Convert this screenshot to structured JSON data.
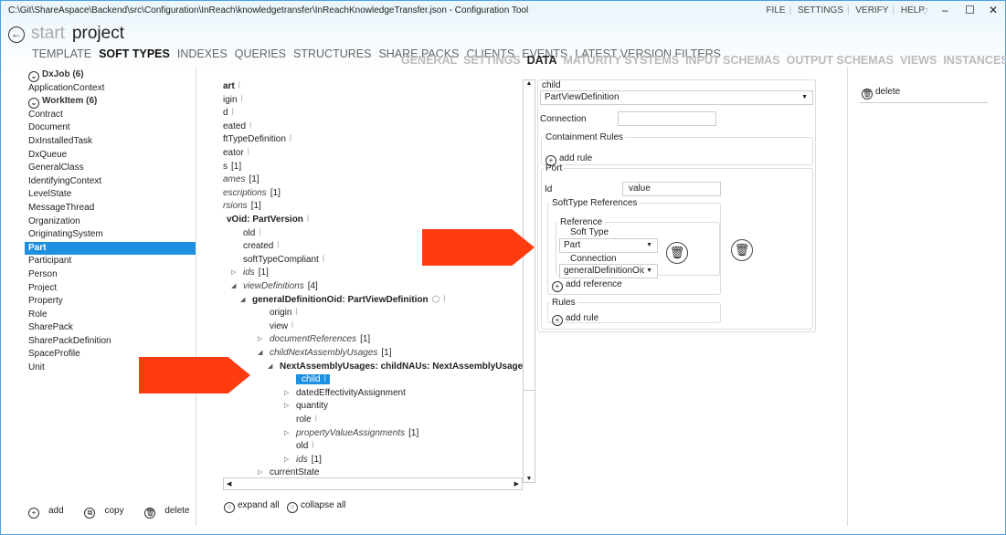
{
  "window": {
    "title": "C:\\Git\\ShareAspace\\Backend\\src\\Configuration\\InReach\\knowledgetransfer\\InReachKnowledgeTransfer.json - Configuration Tool",
    "menu": [
      "FILE",
      "SETTINGS",
      "VERIFY",
      "HELP"
    ]
  },
  "breadcrumb": {
    "start": "start",
    "project": "project"
  },
  "tabs_primary": [
    {
      "label": "TEMPLATE"
    },
    {
      "label": "SOFT TYPES",
      "active": true
    },
    {
      "label": "INDEXES"
    },
    {
      "label": "QUERIES"
    },
    {
      "label": "STRUCTURES"
    },
    {
      "label": "SHARE PACKS"
    },
    {
      "label": "CLIENTS"
    },
    {
      "label": "EVENTS"
    },
    {
      "label": "LATEST VERSION FILTERS"
    }
  ],
  "tabs_secondary": [
    {
      "label": "GENERAL"
    },
    {
      "label": "SETTINGS"
    },
    {
      "label": "DATA",
      "active": true
    },
    {
      "label": "MATURITY SYSTEMS"
    },
    {
      "label": "INPUT SCHEMAS"
    },
    {
      "label": "OUTPUT SCHEMAS"
    },
    {
      "label": "VIEWS"
    },
    {
      "label": "INSTANCES"
    }
  ],
  "sidebar": {
    "items": [
      {
        "label": "DxJob (6)",
        "group": true
      },
      {
        "label": "ApplicationContext"
      },
      {
        "label": "WorkItem (6)",
        "group": true
      },
      {
        "label": "Contract"
      },
      {
        "label": "Document"
      },
      {
        "label": "DxInstalledTask"
      },
      {
        "label": "DxQueue"
      },
      {
        "label": "GeneralClass"
      },
      {
        "label": "IdentifyingContext"
      },
      {
        "label": "LevelState"
      },
      {
        "label": "MessageThread"
      },
      {
        "label": "Organization"
      },
      {
        "label": "OriginatingSystem"
      },
      {
        "label": "Part",
        "selected": true
      },
      {
        "label": "Participant"
      },
      {
        "label": "Person"
      },
      {
        "label": "Project"
      },
      {
        "label": "Property"
      },
      {
        "label": "Role"
      },
      {
        "label": "SharePack"
      },
      {
        "label": "SharePackDefinition"
      },
      {
        "label": "SpaceProfile"
      },
      {
        "label": "Unit"
      }
    ],
    "add": "add",
    "copy": "copy",
    "delete": "delete"
  },
  "tree": {
    "rows": [
      {
        "text": "art",
        "style": "b",
        "level": 0,
        "icon": true
      },
      {
        "text": "igin",
        "level": 0,
        "icon": true
      },
      {
        "text": "d",
        "level": 0,
        "icon": true
      },
      {
        "text": "eated",
        "level": 0,
        "icon": true
      },
      {
        "text": "ftTypeDefinition",
        "level": 0,
        "icon": true
      },
      {
        "text": "eator",
        "level": 0,
        "icon": true
      },
      {
        "text": "s",
        "count": "[1]",
        "level": 0
      },
      {
        "text": "ames",
        "count": "[1]",
        "style": "i",
        "level": 0
      },
      {
        "text": "escriptions",
        "count": "[1]",
        "style": "i",
        "level": 0
      },
      {
        "text": "rsions",
        "count": "[1]",
        "style": "i",
        "level": 0
      },
      {
        "text": "vOid:  PartVersion",
        "style": "b",
        "level": 1,
        "icon": true
      },
      {
        "text": "old",
        "level": 2,
        "icon": true
      },
      {
        "text": "created",
        "level": 2,
        "icon": true
      },
      {
        "text": "softTypeCompliant",
        "level": 2,
        "icon": true
      },
      {
        "text": "ids",
        "count": "[1]",
        "style": "i",
        "level": 2,
        "toggle": "closed"
      },
      {
        "text": "viewDefinitions",
        "count": "[4]",
        "style": "i",
        "level": 2,
        "toggle": "open"
      },
      {
        "text": "generalDefinitionOid:  PartViewDefinition",
        "style": "b",
        "level": 3,
        "toggle": "open",
        "cube": true,
        "icon": true
      },
      {
        "text": "origin",
        "level": 4,
        "icon": true
      },
      {
        "text": "view",
        "level": 4,
        "icon": true
      },
      {
        "text": "documentReferences",
        "count": "[1]",
        "style": "i",
        "level": 4,
        "toggle": "closed"
      },
      {
        "text": "childNextAssemblyUsages",
        "count": "[1]",
        "style": "i",
        "level": 4,
        "toggle": "open"
      },
      {
        "text": "NextAssemblyUsages: childNAUs:  NextAssemblyUsage",
        "style": "b",
        "level": 5,
        "toggle": "open",
        "icon": true,
        "icon2": true
      },
      {
        "text": "child",
        "level": 6,
        "icon": true,
        "selected": true
      },
      {
        "text": "datedEffectivityAssignment",
        "level": 6,
        "toggle": "closed"
      },
      {
        "text": "quantity",
        "level": 6,
        "toggle": "closed"
      },
      {
        "text": "role",
        "level": 6,
        "icon": true
      },
      {
        "text": "propertyValueAssignments",
        "count": "[1]",
        "style": "i",
        "level": 6,
        "toggle": "closed"
      },
      {
        "text": "old",
        "level": 6,
        "icon": true
      },
      {
        "text": "ids",
        "count": "[1]",
        "style": "i",
        "level": 6,
        "toggle": "closed"
      },
      {
        "text": "currentState",
        "level": 4,
        "toggle": "closed"
      }
    ],
    "expand_all": "expand all",
    "collapse_all": "collapse all"
  },
  "editor": {
    "legend": "child",
    "type_value": "PartViewDefinition",
    "connection_label": "Connection",
    "connection_value": "",
    "containment_rules": "Containment Rules",
    "add_rule": "add rule",
    "port": "Port",
    "id_label": "Id",
    "id_value": "value",
    "softtype_refs": "SoftType References",
    "reference": "Reference",
    "soft_type_label": "Soft Type",
    "soft_type_value": "Part",
    "ref_connection_label": "Connection",
    "ref_connection_value": "generalDefinitionOic",
    "add_reference": "add reference",
    "rules": "Rules",
    "add_rule2": "add rule"
  },
  "right": {
    "delete": "delete"
  },
  "colors": {
    "accent": "#1e90e0",
    "arrow": "#ff3b0f"
  }
}
